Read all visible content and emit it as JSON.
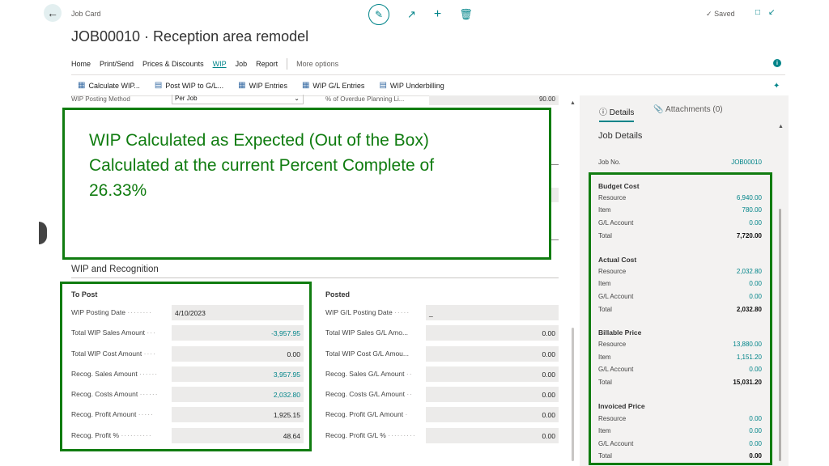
{
  "header": {
    "page_type": "Job Card",
    "title": "JOB00010 · Reception area remodel",
    "saved": "Saved",
    "icons": [
      "back-arrow-icon",
      "edit-icon",
      "share-icon",
      "add-icon",
      "delete-icon",
      "open-new-window-icon",
      "collapse-icon"
    ]
  },
  "menu": {
    "items": [
      "Home",
      "Print/Send",
      "Prices & Discounts",
      "WIP",
      "Job",
      "Report"
    ],
    "active": "WIP",
    "more": "More options"
  },
  "actions": [
    {
      "label": "Calculate WIP...",
      "icon": "calculate-icon"
    },
    {
      "label": "Post WIP to G/L...",
      "icon": "post-icon"
    },
    {
      "label": "WIP Entries",
      "icon": "entries-icon"
    },
    {
      "label": "WIP G/L Entries",
      "icon": "gl-entries-icon"
    },
    {
      "label": "WIP Underbilling",
      "icon": "underbilling-icon"
    }
  ],
  "partial_row": {
    "label": "WIP Posting Method",
    "value": "Per Job",
    "right_label": "% of Overdue Planning Li...",
    "right_value": "90.00"
  },
  "callout": {
    "line1": "WIP Calculated as Expected (Out of the Box)",
    "line2": "Calculated at the current Percent Complete of",
    "line3": "26.33%"
  },
  "section": {
    "title": "WIP and Recognition",
    "to_post": {
      "heading": "To Post",
      "fields": [
        {
          "label": "WIP Posting Date",
          "value": "4/10/2023"
        },
        {
          "label": "Total WIP Sales Amount",
          "value": "-3,957.95"
        },
        {
          "label": "Total WIP Cost Amount",
          "value": "0.00"
        },
        {
          "label": "Recog. Sales Amount",
          "value": "3,957.95"
        },
        {
          "label": "Recog. Costs Amount",
          "value": "2,032.80"
        },
        {
          "label": "Recog. Profit Amount",
          "value": "1,925.15"
        },
        {
          "label": "Recog. Profit %",
          "value": "48.64"
        }
      ]
    },
    "posted": {
      "heading": "Posted",
      "fields": [
        {
          "label": "WIP G/L Posting Date",
          "value": "_"
        },
        {
          "label": "Total WIP Sales G/L Amo...",
          "value": "0.00"
        },
        {
          "label": "Total WIP Cost G/L Amou...",
          "value": "0.00"
        },
        {
          "label": "Recog. Sales G/L Amount",
          "value": "0.00"
        },
        {
          "label": "Recog. Costs G/L Amount",
          "value": "0.00"
        },
        {
          "label": "Recog. Profit G/L Amount",
          "value": "0.00"
        },
        {
          "label": "Recog. Profit G/L %",
          "value": "0.00"
        }
      ]
    }
  },
  "factbox": {
    "tabs": {
      "details": "Details",
      "attachments": "Attachments (0)"
    },
    "title": "Job Details",
    "job_no_label": "Job No.",
    "job_no_value": "JOB00010",
    "groups": [
      {
        "name": "Budget Cost",
        "rows": [
          {
            "label": "Resource",
            "value": "6,940.00"
          },
          {
            "label": "Item",
            "value": "780.00"
          },
          {
            "label": "G/L Account",
            "value": "0.00"
          },
          {
            "label": "Total",
            "value": "7,720.00"
          }
        ]
      },
      {
        "name": "Actual Cost",
        "rows": [
          {
            "label": "Resource",
            "value": "2,032.80"
          },
          {
            "label": "Item",
            "value": "0.00"
          },
          {
            "label": "G/L Account",
            "value": "0.00"
          },
          {
            "label": "Total",
            "value": "2,032.80"
          }
        ]
      },
      {
        "name": "Billable Price",
        "rows": [
          {
            "label": "Resource",
            "value": "13,880.00"
          },
          {
            "label": "Item",
            "value": "1,151.20"
          },
          {
            "label": "G/L Account",
            "value": "0.00"
          },
          {
            "label": "Total",
            "value": "15,031.20"
          }
        ]
      },
      {
        "name": "Invoiced Price",
        "rows": [
          {
            "label": "Resource",
            "value": "0.00"
          },
          {
            "label": "Item",
            "value": "0.00"
          },
          {
            "label": "G/L Account",
            "value": "0.00"
          },
          {
            "label": "Total",
            "value": "0.00"
          }
        ]
      }
    ]
  },
  "colors": {
    "accent": "#008489",
    "highlight": "#107c10"
  }
}
